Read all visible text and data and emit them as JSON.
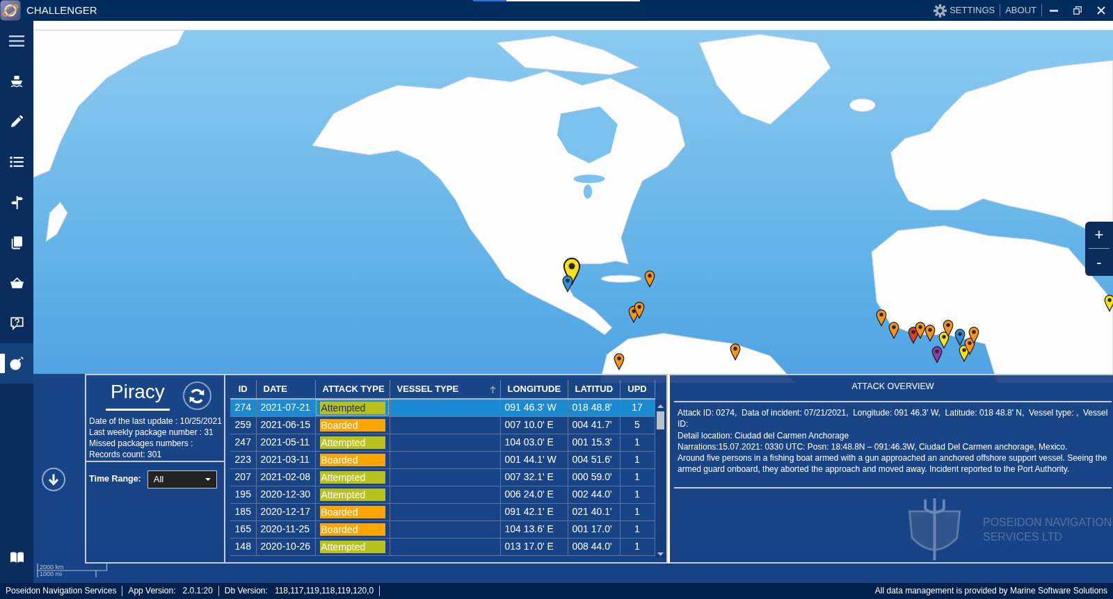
{
  "window": {
    "title": "CHALLENGER",
    "progress": {
      "level": 0.2
    }
  },
  "menu": [
    {
      "label": "SETTINGS",
      "kind": "icon"
    },
    {
      "label": "ABOUT",
      "kind": "text"
    }
  ],
  "sidebar": {
    "items": [
      {
        "selected": false
      },
      {
        "selected": false
      },
      {
        "selected": false
      },
      {
        "selected": false
      },
      {
        "selected": false
      },
      {
        "selected": false
      },
      {
        "selected": false
      },
      {
        "selected": false
      },
      {
        "selected": true
      },
      {
        "selected": false
      }
    ]
  },
  "map": {
    "zoom_controls": [
      "+",
      "-"
    ],
    "scale_labels": [
      "2000 km",
      "1000 mi"
    ]
  },
  "dataset": {
    "title": "Piracy",
    "info": [
      "Date of the last update : 10/25/2021",
      "Last weekly package number : 31",
      "Missed packages numbers :",
      "Records count: 301"
    ],
    "filter": {
      "label": "Time Range:",
      "value": "All"
    }
  },
  "table": {
    "columns": [
      {
        "label": "ID",
        "sorted": false
      },
      {
        "label": "DATE",
        "sorted": false
      },
      {
        "label": "ATTACK TYPE",
        "sorted": false
      },
      {
        "label": "VESSEL TYPE",
        "sorted": true
      },
      {
        "label": "LONGITUDE",
        "sorted": false
      },
      {
        "label": "LATITUD",
        "sorted": false
      },
      {
        "label": "UPD",
        "sorted": false
      }
    ],
    "rows": [
      {
        "id": "274",
        "date": "2021-07-21",
        "attack_type": "Attempted",
        "color": "#b9c21c",
        "longitude": "091 46.3' W",
        "latitude": "018 48.8'",
        "upd": "17",
        "selected": true
      },
      {
        "id": "259",
        "date": "2021-06-15",
        "attack_type": "Boarded",
        "color": "#ffa500",
        "longitude": "007 10.0' E",
        "latitude": "004 41.7'",
        "upd": "5",
        "selected": false
      },
      {
        "id": "247",
        "date": "2021-05-11",
        "attack_type": "Attempted",
        "color": "#b9c21c",
        "longitude": "104 03.0' E",
        "latitude": "001 15.3'",
        "upd": "1",
        "selected": false
      },
      {
        "id": "223",
        "date": "2021-03-11",
        "attack_type": "Boarded",
        "color": "#ffa500",
        "longitude": "001 44.1' W",
        "latitude": "004 51.6'",
        "upd": "1",
        "selected": false
      },
      {
        "id": "207",
        "date": "2021-02-08",
        "attack_type": "Attempted",
        "color": "#b9c21c",
        "longitude": "007 32.1' E",
        "latitude": "000 59.0'",
        "upd": "1",
        "selected": false
      },
      {
        "id": "195",
        "date": "2020-12-30",
        "attack_type": "Attempted",
        "color": "#b9c21c",
        "longitude": "006 24.0' E",
        "latitude": "002 44.0'",
        "upd": "1",
        "selected": false
      },
      {
        "id": "185",
        "date": "2020-12-17",
        "attack_type": "Boarded",
        "color": "#ffa500",
        "longitude": "091 42.1' E",
        "latitude": "021 40.1'",
        "upd": "1",
        "selected": false
      },
      {
        "id": "165",
        "date": "2020-11-25",
        "attack_type": "Boarded",
        "color": "#ffa500",
        "longitude": "104 13.6' E",
        "latitude": "001 17.0'",
        "upd": "1",
        "selected": false
      },
      {
        "id": "148",
        "date": "2020-10-26",
        "attack_type": "Attempted",
        "color": "#b9c21c",
        "longitude": "013 17.0' E",
        "latitude": "008 44.0'",
        "upd": "1",
        "selected": false
      }
    ]
  },
  "overview": {
    "title": "ATTACK OVERVIEW",
    "paragraphs": [
      "Attack ID: 0274,  Data of incident: 07/21/2021,  Longitude: 091 46.3' W,  Latitude: 018 48.8' N,  Vessel type: ,  Vessel ID:",
      "Detail location: Ciudad del Carmen Anchorage",
      "Narrations:15.07.2021: 0330 UTC: Posn: 18:48.8N – 091:46.3W, Ciudad Del Carmen anchorage, Mexico.",
      "Around five persons in a fishing boat armed with a gun approached an anchored offshore support vessel. Seeing the armed guard onboard, they aborted the approach and moved away. Incident reported to the Port Authority."
    ],
    "brand_lines": [
      "POSEIDON NAVIGATION",
      "SERVICES LTD"
    ]
  },
  "status_bar": {
    "company": "Poseidon Navigation Services",
    "fields": [
      {
        "label": "App Version:",
        "value": "2.0.1:20"
      },
      {
        "label": "Db Version:",
        "value": "118,117,119,118,119,120,0"
      }
    ],
    "note": "All data management is provided by Marine Software Solutions"
  }
}
